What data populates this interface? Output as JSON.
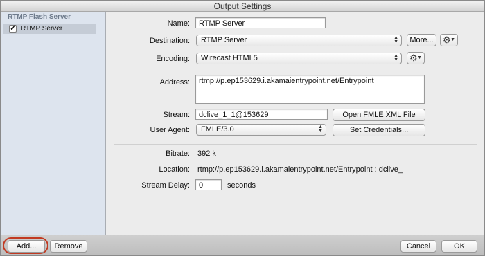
{
  "window": {
    "title": "Output Settings"
  },
  "sidebar": {
    "group_header": "RTMP Flash Server",
    "items": [
      {
        "label": "RTMP Server",
        "checked": true
      }
    ]
  },
  "form": {
    "name": {
      "label": "Name:",
      "value": "RTMP Server"
    },
    "destination": {
      "label": "Destination:",
      "value": "RTMP Server",
      "more_button": "More..."
    },
    "encoding": {
      "label": "Encoding:",
      "value": "Wirecast HTML5"
    },
    "address": {
      "label": "Address:",
      "value": "rtmp://p.ep153629.i.akamaientrypoint.net/Entrypoint"
    },
    "stream": {
      "label": "Stream:",
      "value": "dclive_1_1@153629",
      "button": "Open FMLE XML File"
    },
    "user_agent": {
      "label": "User Agent:",
      "value": "FMLE/3.0",
      "button": "Set Credentials..."
    },
    "bitrate": {
      "label": "Bitrate:",
      "value": "392 k"
    },
    "location": {
      "label": "Location:",
      "value": "rtmp://p.ep153629.i.akamaientrypoint.net/Entrypoint : dclive_"
    },
    "stream_delay": {
      "label": "Stream Delay:",
      "value": "0",
      "unit": "seconds"
    }
  },
  "footer": {
    "add_button": "Add...",
    "remove_button": "Remove",
    "cancel_button": "Cancel",
    "ok_button": "OK"
  },
  "colors": {
    "highlight_ring": "#c23a22",
    "sidebar_bg": "#dde4ee",
    "selected_item_bg": "#c5ccd6"
  },
  "icons": {
    "gear": "gear-icon",
    "checkmark": "checkmark-icon",
    "select_arrows": "updown-arrows-icon"
  }
}
